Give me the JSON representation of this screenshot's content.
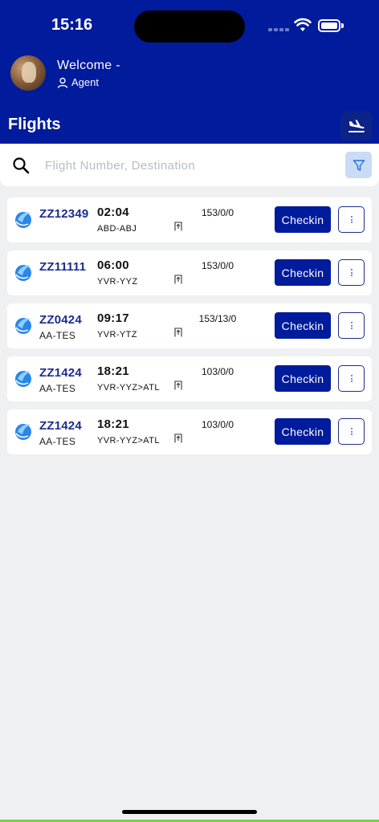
{
  "status_bar": {
    "time": "15:16"
  },
  "header": {
    "welcome": "Welcome -",
    "role": "Agent",
    "title": "Flights"
  },
  "search": {
    "placeholder": "Flight Number, Destination"
  },
  "flights": [
    {
      "flight_no": "ZZ12349",
      "sub": "",
      "time": "02:04",
      "route": "ABD-ABJ",
      "pax": "153/0/0",
      "action": "Checkin"
    },
    {
      "flight_no": "ZZ11111",
      "sub": "",
      "time": "06:00",
      "route": "YVR-YYZ",
      "pax": "153/0/0",
      "action": "Checkin"
    },
    {
      "flight_no": "ZZ0424",
      "sub": "AA-TES",
      "time": "09:17",
      "route": "YVR-YTZ",
      "pax": "153/13/0",
      "action": "Checkin"
    },
    {
      "flight_no": "ZZ1424",
      "sub": "AA-TES",
      "time": "18:21",
      "route": "YVR-YYZ>ATL",
      "pax": "103/0/0",
      "action": "Checkin"
    },
    {
      "flight_no": "ZZ1424",
      "sub": "AA-TES",
      "time": "18:21",
      "route": "YVR-YYZ>ATL",
      "pax": "103/0/0",
      "action": "Checkin"
    }
  ],
  "icons": {
    "landing": "airplane-landing-icon",
    "filter": "filter-icon",
    "search": "search-icon",
    "more": "more-vertical-icon",
    "gate": "gate-icon",
    "logo": "airline-logo-icon"
  },
  "colors": {
    "header_bg": "#001b9b",
    "accent": "#1b2d8f",
    "filter_bg": "#c9dcf6",
    "page_bg": "#eff0f2"
  }
}
